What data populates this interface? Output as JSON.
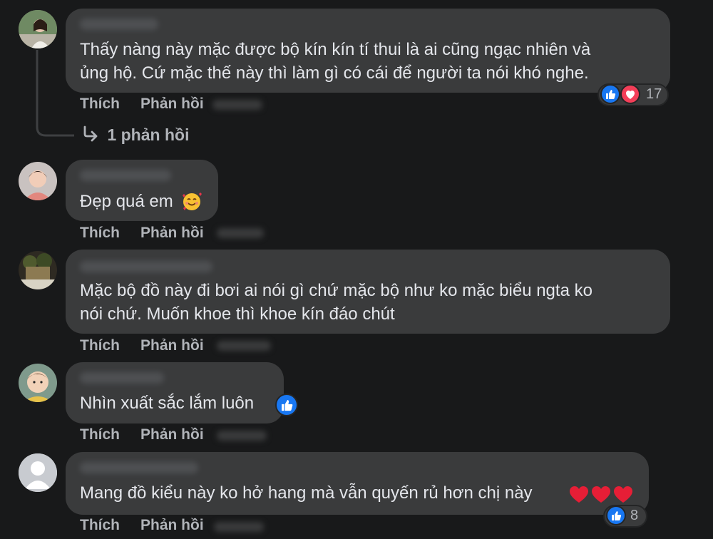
{
  "actions": {
    "like": "Thích",
    "reply": "Phản hồi"
  },
  "comments": [
    {
      "lines": [
        "Thấy nàng này mặc được bộ kín kín tí thui là ai cũng ngạc nhiên và",
        "ủng hộ. Cứ mặc thế này thì làm gì có cái để người ta nói khó nghe."
      ],
      "reaction_count": "17",
      "reactions": [
        "like-reaction-icon",
        "love-reaction-icon"
      ]
    },
    {
      "lines": [
        "Đẹp quá em"
      ],
      "emoji": "smiling-face-with-hearts-icon"
    },
    {
      "lines": [
        "Mặc bộ đồ này đi bơi ai nói gì chứ mặc bộ như ko mặc biểu ngta ko",
        "nói chứ. Muốn khoe thì khoe kín đáo chút"
      ]
    },
    {
      "lines": [
        "Nhìn xuất sắc lắm luôn"
      ],
      "reactions": [
        "like-reaction-icon"
      ]
    },
    {
      "lines": [
        "Mang đồ kiểu này ko hở hang mà vẫn quyến rủ hơn chị này"
      ],
      "emoji": "red-heart-icon",
      "reaction_count": "8",
      "reactions": [
        "like-reaction-icon"
      ]
    }
  ],
  "replies_link": {
    "label": "1 phản hồi",
    "icon": "reply-arrow-icon"
  },
  "colors": {
    "background": "#18191a",
    "bubble": "#3a3b3c",
    "text": "#e4e6eb",
    "secondary": "#b0b3b8",
    "like_blue": "#1877f2",
    "love_red": "#f33e58"
  }
}
